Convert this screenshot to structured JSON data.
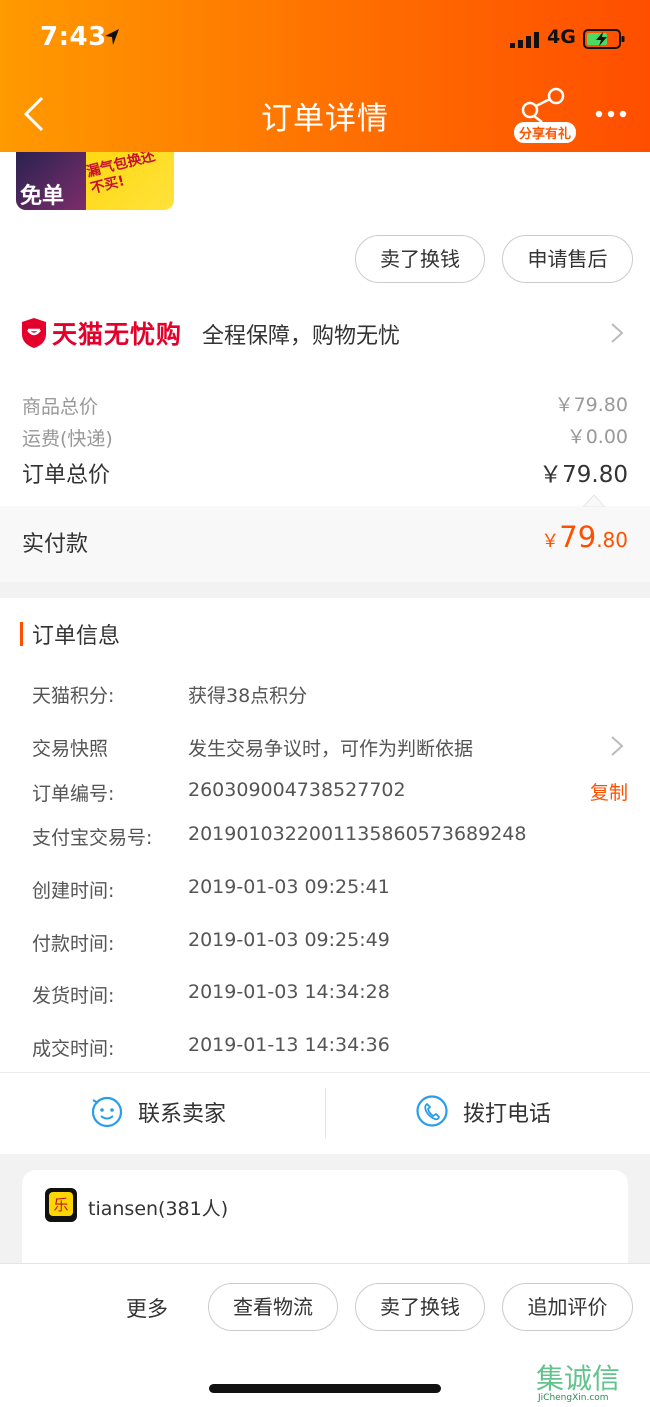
{
  "status_bar": {
    "time": "7:43",
    "network": "4G"
  },
  "nav": {
    "title": "订单详情",
    "share_tag": "分享有礼"
  },
  "product_banner": {
    "badge": "免单",
    "slogan": "漏气包换还不买!"
  },
  "actions_top": {
    "sell_label": "卖了换钱",
    "aftersale_label": "申请售后"
  },
  "tmall_guarantee": {
    "brand": "天猫无忧购",
    "desc": "全程保障，购物无忧"
  },
  "price": {
    "goods_total_label": "商品总价",
    "goods_total_value": "￥79.80",
    "shipping_label": "运费(快递)",
    "shipping_value": "￥0.00",
    "order_total_label": "订单总价",
    "order_total_value": "￥79.80",
    "paid_label": "实付款",
    "paid_currency": "￥",
    "paid_int": "79",
    "paid_dec": ".80"
  },
  "order_info": {
    "title": "订单信息",
    "rows": [
      {
        "key": "天猫积分:",
        "value": "获得38点积分"
      },
      {
        "key": "交易快照",
        "value": "发生交易争议时，可作为判断依据"
      },
      {
        "key": "订单编号:",
        "value": "260309004738527702"
      },
      {
        "key": "支付宝交易号:",
        "value": "2019010322001135860573689248"
      },
      {
        "key": "创建时间:",
        "value": "2019-01-03 09:25:41"
      },
      {
        "key": "付款时间:",
        "value": "2019-01-03 09:25:49"
      },
      {
        "key": "发货时间:",
        "value": "2019-01-03 14:34:28"
      },
      {
        "key": "成交时间:",
        "value": "2019-01-13 14:34:36"
      }
    ],
    "copy_label": "复制"
  },
  "contact": {
    "seller_label": "联系卖家",
    "phone_label": "拨打电话"
  },
  "group": {
    "name": "tiansen(381人)"
  },
  "bottom_bar": {
    "more_label": "更多",
    "logistics_label": "查看物流",
    "sell_label": "卖了换钱",
    "review_label": "追加评价"
  },
  "watermark": {
    "text": "集诚信",
    "url": "JiChengXin.com"
  },
  "colors": {
    "accent": "#ff5000",
    "header_from": "#ff9a00",
    "header_to": "#ff4e00",
    "tmall_red": "#e4002b"
  }
}
